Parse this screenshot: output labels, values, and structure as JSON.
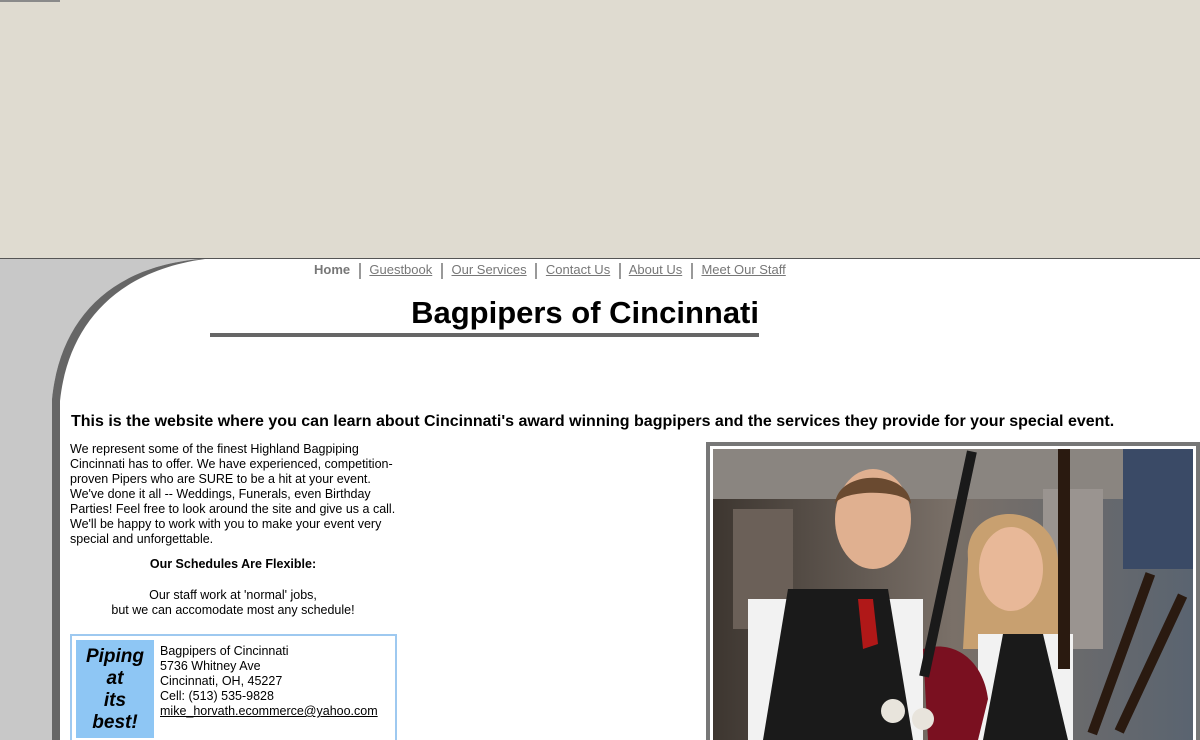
{
  "nav": {
    "home": "Home",
    "guestbook": "Guestbook",
    "services": "Our Services",
    "contact": "Contact Us",
    "about": "About Us",
    "staff": "Meet Our Staff"
  },
  "header": {
    "title": "Bagpipers of Cincinnati"
  },
  "main": {
    "tagline": "This is the website where you can learn about Cincinnati's award winning bagpipers and the services they provide for your special event.",
    "intro": "We represent some of the finest Highland Bagpiping Cincinnati has to offer.  We have experienced, competition-proven Pipers who are SURE to be a hit at your event.  We've done it all -- Weddings, Funerals, even Birthday Parties!  Feel free to look around the site and give us a call.  We'll be happy to work with you to make your event very special and unforgettable.",
    "schedule_title": "Our Schedules Are Flexible:",
    "schedule_line1": "Our staff work at 'normal' jobs,",
    "schedule_line2": "but we can accomodate most any schedule!"
  },
  "contact": {
    "badge_line1": "Piping",
    "badge_line2": "at",
    "badge_line3": "its",
    "badge_line4": "best!",
    "name": "Bagpipers of Cincinnati",
    "street": "5736 Whitney Ave",
    "city": "Cincinnati, OH, 45227",
    "phone": "Cell: (513) 535-9828",
    "email": "mike_horvath.ecommerce@yahoo.com"
  },
  "colors": {
    "top_band": "#dfdbd0",
    "accent_blue": "#8ec6f4",
    "frame_gray": "#777777"
  }
}
